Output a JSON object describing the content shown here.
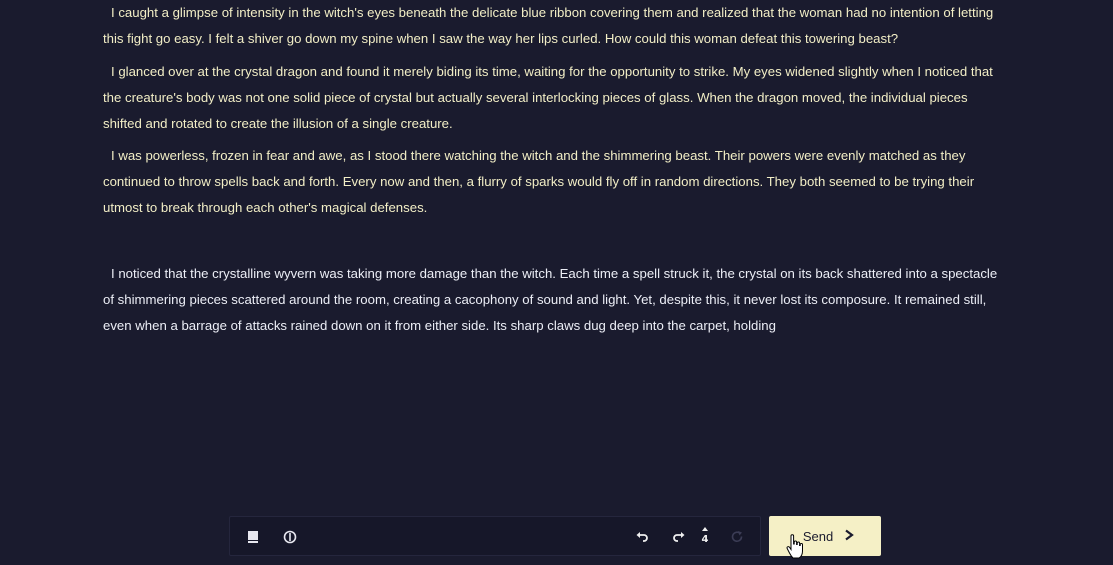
{
  "story": {
    "paragraphs": [
      "I caught a glimpse of intensity in the witch's eyes beneath the delicate blue ribbon covering them and realized that the woman had no intention of letting this fight go easy. I felt a shiver go down my spine when I saw the way her lips curled. How could this woman defeat this towering beast?",
      "I glanced over at the crystal dragon and found it merely biding its time, waiting for the opportunity to strike. My eyes widened slightly when I noticed that the creature's body was not one solid piece of crystal but actually several interlocking pieces of glass. When the dragon moved, the individual pieces shifted and rotated to create the illusion of a single creature.",
      "I was powerless, frozen in fear and awe, as I stood there watching the witch and the shimmering beast. Their powers were evenly matched as they continued to throw spells back and forth. Every now and then, a flurry of sparks would fly off in random directions. They both seemed to be trying their utmost to break through each other's magical defenses.",
      "I noticed that the crystalline wyvern was taking more damage than the witch. Each time a spell struck it, the crystal on its back shattered into a spectacle of shimmering pieces scattered around the room, creating a cacophony of sound and light. Yet, despite this, it never lost its composure. It remained still, even when a barrage of attacks rained down on it from either side. Its sharp claws dug deep into the carpet, holding"
    ]
  },
  "toolbar": {
    "icons": {
      "memory": "book-icon",
      "world_info": "compass-icon",
      "undo": "undo-icon",
      "redo": "redo-icon",
      "retry": "retry-icon"
    },
    "redo_count": "4",
    "send_label": "Send"
  },
  "colors": {
    "background": "#1a1b2e",
    "story_text": "#f2eec6",
    "latest_text": "#eceef6",
    "toolbar_bg": "#161729",
    "send_bg": "#f5f0c6"
  }
}
